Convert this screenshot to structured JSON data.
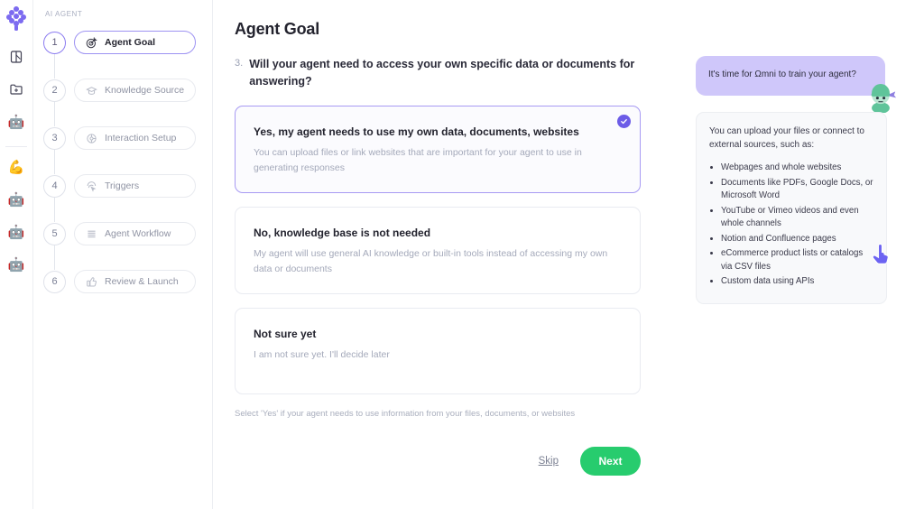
{
  "rail": {
    "logo_name": "grape-cluster-logo",
    "items": [
      {
        "name": "palette-icon",
        "glyph": "palette"
      },
      {
        "name": "add-folder-icon",
        "glyph": "folder-plus"
      },
      {
        "name": "robot-icon-1",
        "glyph": "robot"
      },
      {
        "name": "muscle-icon",
        "glyph": "muscle"
      },
      {
        "name": "robot-icon-2",
        "glyph": "robot"
      },
      {
        "name": "robot-icon-3",
        "glyph": "robot"
      },
      {
        "name": "robot-icon-4",
        "glyph": "robot"
      }
    ]
  },
  "sidebar": {
    "kicker": "AI AGENT",
    "steps": [
      {
        "num": "1",
        "label": "Agent Goal",
        "icon": "target-icon",
        "active": true
      },
      {
        "num": "2",
        "label": "Knowledge Source",
        "icon": "graduation-cap-icon",
        "active": false
      },
      {
        "num": "3",
        "label": "Interaction Setup",
        "icon": "gear-icon",
        "active": false
      },
      {
        "num": "4",
        "label": "Triggers",
        "icon": "click-icon",
        "active": false
      },
      {
        "num": "5",
        "label": "Agent Workflow",
        "icon": "list-lines-icon",
        "active": false
      },
      {
        "num": "6",
        "label": "Review & Launch",
        "icon": "thumbs-up-icon",
        "active": false
      }
    ]
  },
  "main": {
    "title": "Agent Goal",
    "question_number": "3.",
    "question": "Will your agent need to access your own specific data or documents for answering?",
    "options": [
      {
        "title": "Yes, my agent needs to use my own data, documents, websites",
        "desc": "You can upload files or link websites that are important for your agent to use in generating responses",
        "selected": true
      },
      {
        "title": "No, knowledge base is not needed",
        "desc": "My agent will use general AI knowledge or built-in tools instead of accessing my own data or documents",
        "selected": false
      },
      {
        "title": "Not sure yet",
        "desc": "I am not sure yet. I'll decide later",
        "selected": false
      }
    ],
    "hint": "Select 'Yes' if your agent needs to use information from your files, documents, or websites",
    "skip_label": "Skip",
    "next_label": "Next"
  },
  "helper": {
    "bubble_text": "It's time for Ωmni to train your agent?",
    "mascot_name": "ninja-mascot",
    "tips_intro": "You can upload your files or connect to external sources, such as:",
    "tips": [
      "Webpages and whole websites",
      "Documents like PDFs, Google Docs, or Microsoft Word",
      "YouTube or Vimeo videos and even whole channels",
      "Notion and Confluence pages",
      "eCommerce product lists or catalogs via CSV files",
      "Custom data using APIs"
    ]
  },
  "colors": {
    "accent_purple": "#6c5ce7",
    "bubble_purple": "#cfc7fa",
    "next_green": "#27cc6e",
    "mascot_green": "#5fc49a"
  }
}
